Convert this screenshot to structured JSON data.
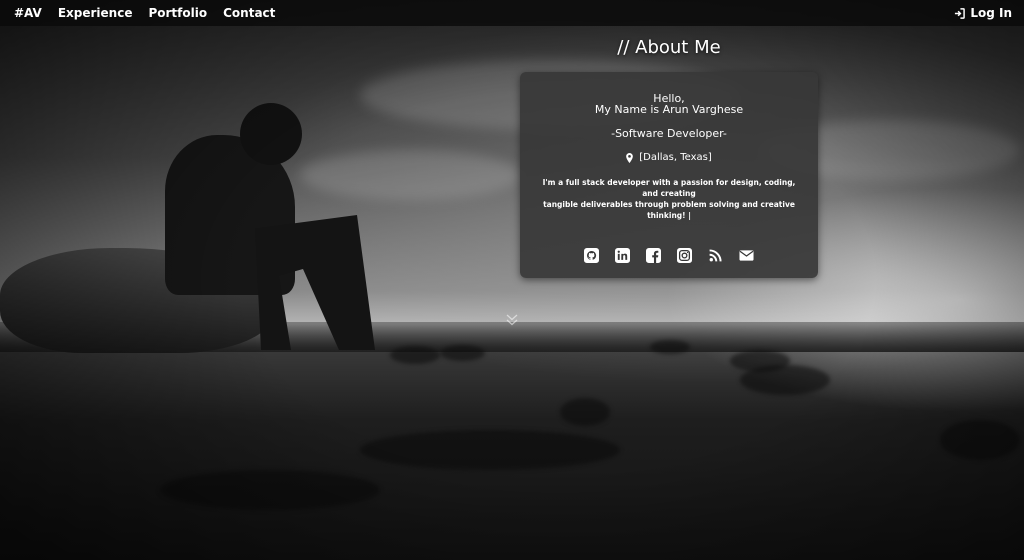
{
  "navbar": {
    "brand": "#AV",
    "links": [
      "Experience",
      "Portfolio",
      "Contact"
    ],
    "login_label": "Log In"
  },
  "about": {
    "title": "// About Me",
    "greeting": "Hello,",
    "name_line": "My Name is Arun Varghese",
    "role": "-Software Developer-",
    "location": "[Dallas, Texas]",
    "bio_line1": "I'm a full stack developer with a passion for design, coding, and creating",
    "bio_line2": "tangible deliverables through problem solving and creative thinking! |"
  },
  "socials": [
    "github-icon",
    "linkedin-icon",
    "facebook-icon",
    "instagram-icon",
    "rss-icon",
    "email-icon"
  ],
  "colors": {
    "navbar_bg": "#0a0a0a",
    "card_bg": "#373737",
    "text": "#ffffff"
  }
}
